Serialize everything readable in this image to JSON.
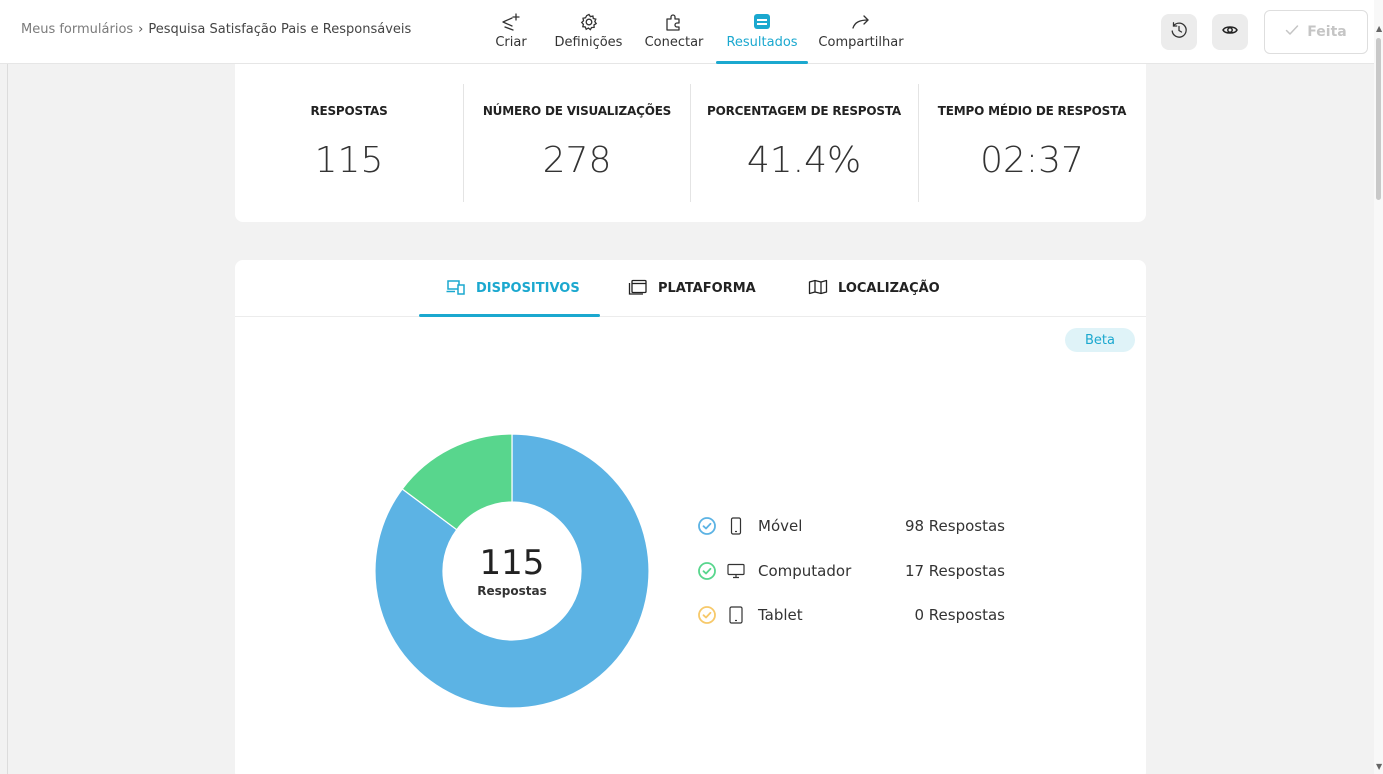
{
  "breadcrumb": {
    "root": "Meus formulários",
    "separator": "›",
    "current": "Pesquisa Satisfação Pais e Responsáveis"
  },
  "nav": [
    {
      "label": "Criar",
      "icon": "create-icon"
    },
    {
      "label": "Definições",
      "icon": "gear-icon"
    },
    {
      "label": "Conectar",
      "icon": "puzzle-icon"
    },
    {
      "label": "Resultados",
      "icon": "inbox-icon",
      "active": true
    },
    {
      "label": "Compartilhar",
      "icon": "share-arrow-icon"
    }
  ],
  "toolbar": {
    "history_icon": "history-icon",
    "preview_icon": "eye-icon",
    "done_label": "Feita"
  },
  "stats": [
    {
      "label": "RESPOSTAS",
      "value": "115"
    },
    {
      "label": "NÚMERO DE VISUALIZAÇÕES",
      "value": "278"
    },
    {
      "label": "PORCENTAGEM DE RESPOSTA",
      "value": "41.4%"
    },
    {
      "label": "TEMPO MÉDIO DE RESPOSTA",
      "value": "02:37"
    }
  ],
  "tabs": [
    {
      "label": "DISPOSITIVOS",
      "icon": "devices-icon",
      "active": true
    },
    {
      "label": "PLATAFORMA",
      "icon": "windows-icon"
    },
    {
      "label": "LOCALIZAÇÃO",
      "icon": "map-icon"
    }
  ],
  "badge": "Beta",
  "donut": {
    "total": "115",
    "total_label": "Respostas"
  },
  "devices": [
    {
      "name": "Móvel",
      "count_label": "98 Respostas",
      "value": 98,
      "color": "#5cb3e4",
      "icon": "mobile-icon"
    },
    {
      "name": "Computador",
      "count_label": "17 Respostas",
      "value": 17,
      "color": "#58d68d",
      "icon": "desktop-icon"
    },
    {
      "name": "Tablet",
      "count_label": "0 Respostas",
      "value": 0,
      "color": "#f7c96a",
      "icon": "tablet-icon"
    }
  ],
  "colors": {
    "accent": "#1ba8cf"
  }
}
